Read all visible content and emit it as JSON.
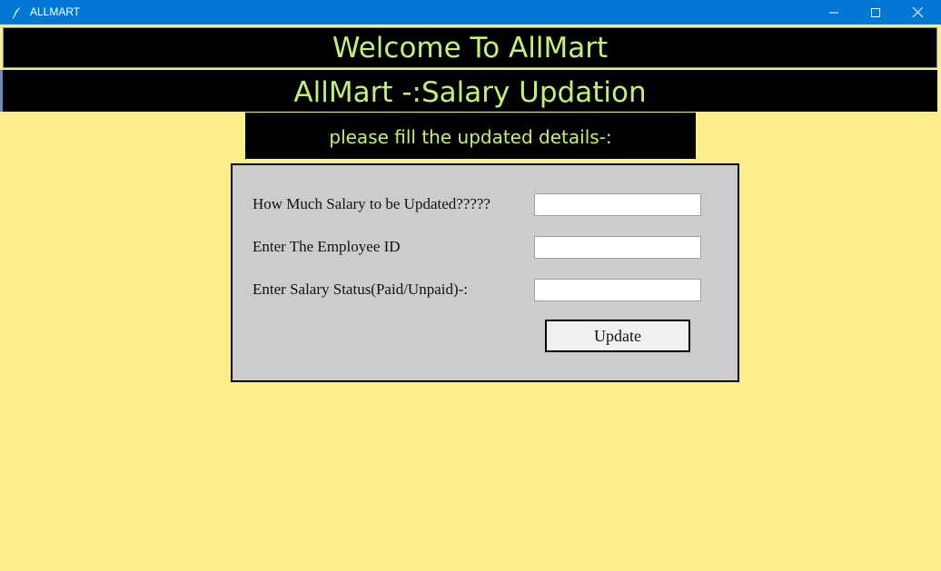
{
  "window": {
    "title": "ALLMART",
    "controls": {
      "minimize_icon": "minimize-icon",
      "maximize_icon": "maximize-icon",
      "close_icon": "close-icon"
    }
  },
  "header": {
    "welcome": "Welcome To AllMart",
    "page_title": "AllMart -:Salary Updation",
    "instruction": "please fill the updated details-:"
  },
  "form": {
    "fields": [
      {
        "label": "How Much Salary to be Updated?????",
        "value": ""
      },
      {
        "label": "Enter The Employee ID",
        "value": ""
      },
      {
        "label": "Enter Salary Status(Paid/Unpaid)-:",
        "value": ""
      }
    ],
    "submit_label": "Update"
  },
  "colors": {
    "titlebar": "#0078d4",
    "background": "#ffec8b",
    "banner": "#000000",
    "banner_text": "#c4f07a",
    "panel": "#cccccc"
  }
}
